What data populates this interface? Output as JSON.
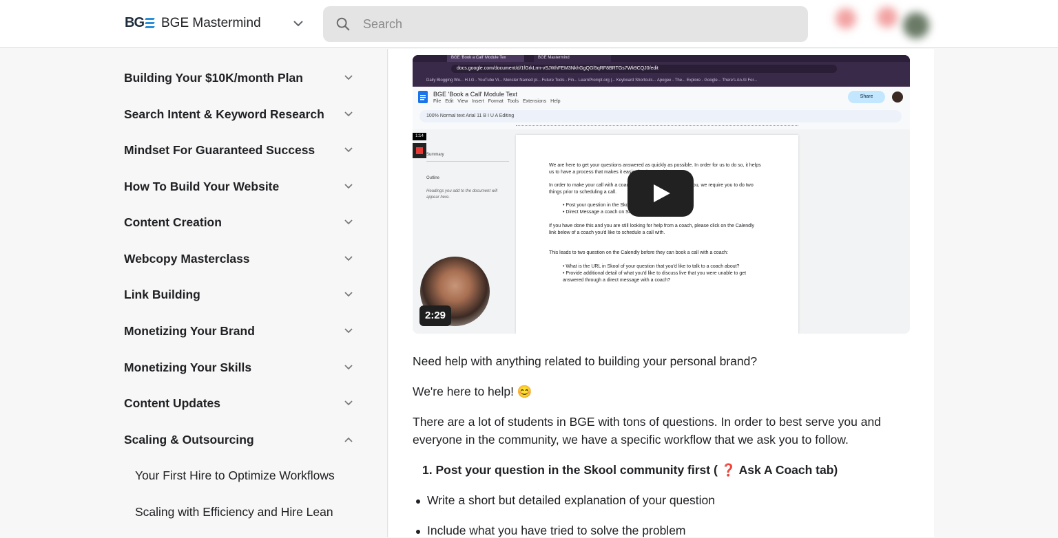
{
  "header": {
    "logo_text": "BG",
    "brand_name": "BGE Mastermind",
    "search_placeholder": "Search"
  },
  "sidebar": {
    "modules": [
      {
        "label": "Building Your $10K/month Plan",
        "expanded": false
      },
      {
        "label": "Search Intent & Keyword Research",
        "expanded": false
      },
      {
        "label": "Mindset For Guaranteed Success",
        "expanded": false
      },
      {
        "label": "How To Build Your Website",
        "expanded": false
      },
      {
        "label": "Content Creation",
        "expanded": false
      },
      {
        "label": "Webcopy Masterclass",
        "expanded": false
      },
      {
        "label": "Link Building",
        "expanded": false
      },
      {
        "label": "Monetizing Your Brand",
        "expanded": false
      },
      {
        "label": "Monetizing Your Skills",
        "expanded": false
      },
      {
        "label": "Content Updates",
        "expanded": false
      },
      {
        "label": "Scaling & Outsourcing",
        "expanded": true
      }
    ],
    "lessons": [
      {
        "label": "Your First Hire to Optimize Workflows"
      },
      {
        "label": "Scaling with Efficiency and Hire Lean"
      }
    ]
  },
  "video": {
    "duration": "2:29",
    "recording_time": "1:14",
    "browser": {
      "tab1": "BGE 'Book a Call' Module Tex",
      "tab2": "BGE Mastermind",
      "url": "docs.google.com/document/d/1fGrkLrm-vSJWhFEM3NkhGgQGl5qRF8BRTGs7Wk9CQJ0/edit",
      "bookmarks": "Daily Blogging Wo...   H.I.G - YouTube Vi...   Monster Named pl...   Future Tools - Fin...   LearnPrompt.org |...   Keyboard Shortcuts...   Apogee - The...   Explore - Google...   There's An AI For..."
    },
    "doc": {
      "title": "BGE 'Book a Call' Module Text",
      "menu": "File Edit View Insert Format Tools Extensions Help",
      "share_label": "Share",
      "toolbar": "100%   Normal text   Arial   11   B  I  U  A      Editing",
      "summary_label": "Summary",
      "outline_label": "Outline",
      "outline_hint": "Headings you add to the document will appear here.",
      "lines": [
        "We are here to get your questions answered as quickly as possible.  In order for us to do so, it helps us to have a process that makes it easier for the coaching team.",
        "In order to make your call with a coach as effective and helpful for you, we require you to do two things prior to scheduling a call.",
        "• Post your question in the Skool community",
        "• Direct Message a coach on Skool",
        "If you have done this and you are still looking for help from a coach, please click on the Calendly link below of a coach you'd like to schedule a call with.",
        "This leads to two question on the Calendly before they can book a call with a coach:",
        "• What is the URL in Skool of your question that you'd like to talk to a coach about?",
        "• Provide additional detail of what you'd like to discuss live that you were unable to get answered through a direct message with a coach?"
      ]
    }
  },
  "content": {
    "p1": "Need help with anything related to building your personal brand?",
    "p2": "We're here to help! 😊",
    "p3": "There are a lot of students in BGE with tons of questions. In order to best serve you and everyone in the community, we have a specific workflow that we ask you to follow.",
    "step1": "1. Post your question in the Skool community first ( ❓ Ask A Coach tab)",
    "bullets": [
      "Write a short but detailed explanation of your question",
      "Include what you have tried to solve the problem"
    ]
  },
  "colors": {
    "accent": "#2b8ed8",
    "sidebar_bg": "#f7f7f7",
    "search_bg": "#e4e4e4"
  }
}
